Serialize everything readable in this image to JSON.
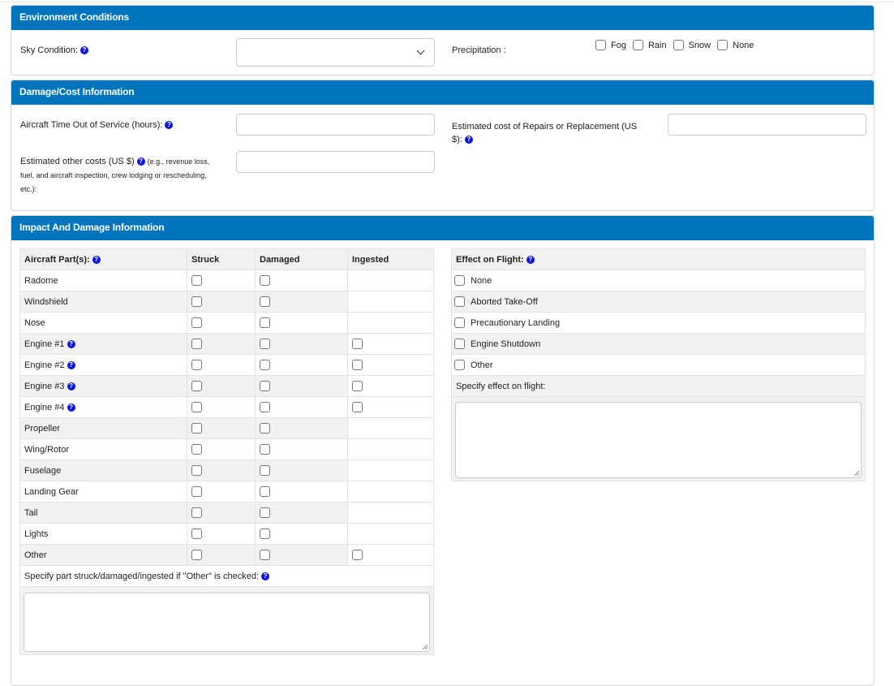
{
  "environment": {
    "title": "Environment Conditions",
    "sky_label": "Sky Condition:",
    "sky_value": "",
    "precip_label": "Precipitation :",
    "precip_options": [
      "Fog",
      "Rain",
      "Snow",
      "None"
    ]
  },
  "damage": {
    "title": "Damage/Cost Information",
    "time_out_label": "Aircraft Time Out of Service (hours):",
    "repairs_label": "Estimated cost of Repairs or Replacement (US $):",
    "other_costs_label": "Estimated other costs (US $)",
    "other_costs_note": "(e.g., revenue loss, fuel, and aircraft inspection, crew lodging or rescheduling, etc.):"
  },
  "impact": {
    "title": "Impact And Damage Information",
    "parts_table": {
      "headers": [
        "Aircraft Part(s):",
        "Struck",
        "Damaged",
        "Ingested"
      ],
      "rows": [
        {
          "part": "Radome",
          "help": false,
          "ingested": false
        },
        {
          "part": "Windshield",
          "help": false,
          "ingested": false
        },
        {
          "part": "Nose",
          "help": false,
          "ingested": false
        },
        {
          "part": "Engine #1",
          "help": true,
          "ingested": true
        },
        {
          "part": "Engine #2",
          "help": true,
          "ingested": true
        },
        {
          "part": "Engine #3",
          "help": true,
          "ingested": true
        },
        {
          "part": "Engine #4",
          "help": true,
          "ingested": true
        },
        {
          "part": "Propeller",
          "help": false,
          "ingested": false
        },
        {
          "part": "Wing/Rotor",
          "help": false,
          "ingested": false
        },
        {
          "part": "Fuselage",
          "help": false,
          "ingested": false
        },
        {
          "part": "Landing Gear",
          "help": false,
          "ingested": false
        },
        {
          "part": "Tail",
          "help": false,
          "ingested": false
        },
        {
          "part": "Lights",
          "help": false,
          "ingested": false
        },
        {
          "part": "Other",
          "help": false,
          "ingested": true
        }
      ],
      "specify_label": "Specify part struck/damaged/ingested if \"Other\" is checked:"
    },
    "effect_table": {
      "header": "Effect on Flight:",
      "options": [
        "None",
        "Aborted Take-Off",
        "Precautionary Landing",
        "Engine Shutdown",
        "Other"
      ],
      "specify_label": "Specify effect on flight:"
    }
  }
}
